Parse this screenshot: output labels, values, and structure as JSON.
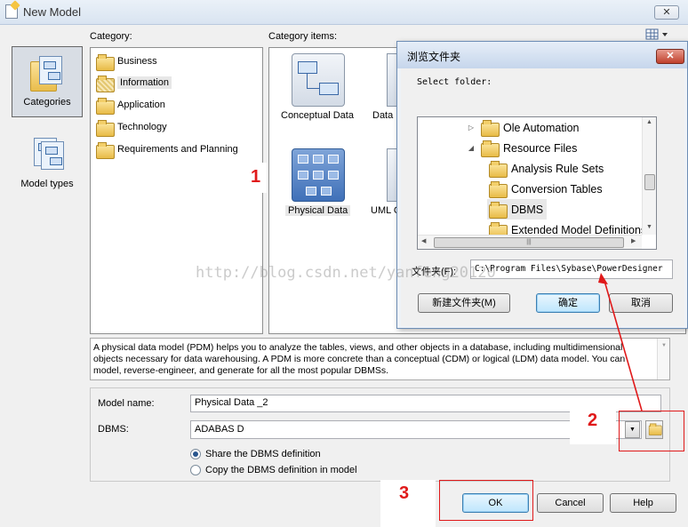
{
  "window": {
    "title": "New Model",
    "close_label": "✕"
  },
  "sidebar": {
    "categories_label": "Categories",
    "model_types_label": "Model types"
  },
  "category": {
    "header": "Category:",
    "items": [
      {
        "label": "Business"
      },
      {
        "label": "Information"
      },
      {
        "label": "Application"
      },
      {
        "label": "Technology"
      },
      {
        "label": "Requirements and Planning"
      }
    ]
  },
  "category_items": {
    "header": "Category items:",
    "items": [
      {
        "label": "Conceptual Data"
      },
      {
        "label": "Data"
      },
      {
        "label": "Physical Data"
      },
      {
        "label": "UML C"
      }
    ]
  },
  "description": "A physical data model (PDM) helps you to analyze the tables, views, and other objects in a database, including multidimensional objects necessary for data warehousing. A PDM is more concrete than a conceptual (CDM) or logical (LDM) data model. You can model, reverse-engineer, and generate for all the most popular DBMSs.",
  "form": {
    "model_name_label": "Model name:",
    "model_name_value": "Physical Data _2",
    "dbms_label": "DBMS:",
    "dbms_value": "ADABAS D",
    "share_label": "Share the DBMS definition",
    "copy_label": "Copy the DBMS definition in model"
  },
  "buttons": {
    "ok": "OK",
    "cancel": "Cancel",
    "help": "Help"
  },
  "browse_dialog": {
    "title": "浏览文件夹",
    "close_label": "✕",
    "prompt": "Select folder:",
    "tree": [
      {
        "label": "Ole Automation",
        "expander": "▷"
      },
      {
        "label": "Resource Files",
        "expander": "◢"
      },
      {
        "label": "Analysis Rule Sets",
        "expander": ""
      },
      {
        "label": "Conversion Tables",
        "expander": ""
      },
      {
        "label": "DBMS",
        "expander": ""
      },
      {
        "label": "Extended Model Definitions",
        "expander": ""
      }
    ],
    "folder_label": "文件夹(F):",
    "folder_value": "C:\\Program Files\\Sybase\\PowerDesigner",
    "new_folder_button": "新建文件夹(M)",
    "ok_button": "确定",
    "cancel_button": "取消"
  },
  "annotations": {
    "marker_1": "1",
    "marker_2": "2",
    "marker_3": "3",
    "watermark": "http://blog.csdn.net/yanfeng20120",
    "accent_color": "#e0191a"
  },
  "icons": [
    "folder-icon",
    "pdm-icon",
    "cdm-icon",
    "browse-folder-icon",
    "view-toggle-icon"
  ]
}
